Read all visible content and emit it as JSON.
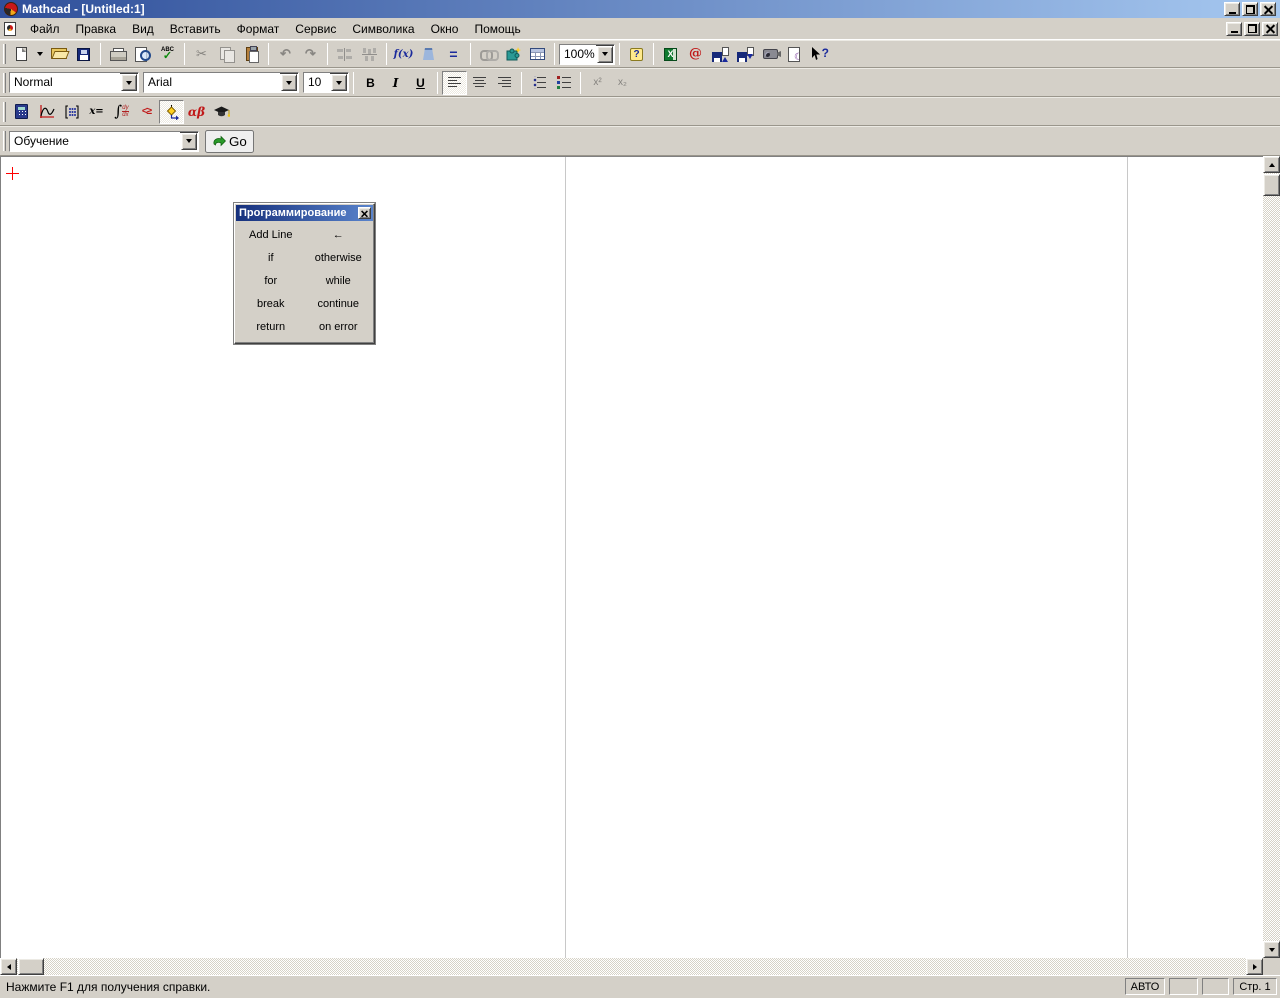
{
  "window": {
    "title": "Mathcad - [Untitled:1]"
  },
  "menubar": {
    "items": [
      "Файл",
      "Правка",
      "Вид",
      "Вставить",
      "Формат",
      "Сервис",
      "Символика",
      "Окно",
      "Помощь"
    ]
  },
  "standard_toolbar": {
    "zoom": "100%"
  },
  "glyphs": {
    "cut": "✂",
    "undo": "↶",
    "redo": "↷",
    "spell_abc": "ABC",
    "spell_check": "✓",
    "fx": "f(x)",
    "equals": "=",
    "help": "?",
    "excel_x": "X",
    "collab_at": "@",
    "wizard_moon": "☾",
    "ctx_q": "?",
    "go_arrow": "➔"
  },
  "formatting_toolbar": {
    "style": "Normal",
    "font": "Arial",
    "size": "10",
    "bold": "B",
    "italic": "I",
    "underline": "U",
    "superscript": "x²",
    "subscript": "x₂"
  },
  "math_toolbar": {
    "xeq": "x=",
    "integral": "∫",
    "d_top": "dy",
    "d_bottom": "dx",
    "bool": "<≥",
    "greek": "αβ"
  },
  "resources_toolbar": {
    "value": "Обучение",
    "go": "Go"
  },
  "palette": {
    "title": "Программирование",
    "buttons": [
      "Add Line",
      "←",
      "if",
      "otherwise",
      "for",
      "while",
      "break",
      "continue",
      "return",
      "on error"
    ]
  },
  "statusbar": {
    "message": "Нажмите F1 для получения справки.",
    "auto": "АВТО",
    "page": "Стр. 1"
  }
}
